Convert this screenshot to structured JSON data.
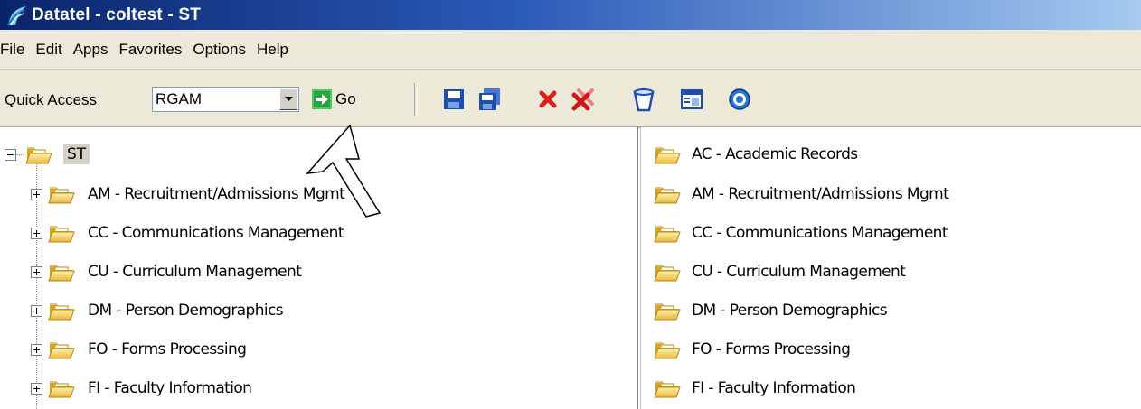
{
  "window": {
    "title": "Datatel - coltest - ST"
  },
  "menubar": {
    "items": [
      "File",
      "Edit",
      "Apps",
      "Favorites",
      "Options",
      "Help"
    ]
  },
  "toolbar": {
    "quick_access_label": "Quick Access",
    "quick_access_value": "RGAM",
    "go_label": "Go",
    "icons": [
      "save-icon",
      "save-all-icon",
      "cancel-icon",
      "cancel-all-icon",
      "clear-icon",
      "form-list-icon",
      "help-icon"
    ]
  },
  "tree": {
    "root": {
      "label": "ST"
    },
    "children": [
      "AM - Recruitment/Admissions Mgmt",
      "CC - Communications Management",
      "CU - Curriculum Management",
      "DM - Person Demographics",
      "FO - Forms Processing",
      "FI - Faculty Information"
    ]
  },
  "right_pane": {
    "items": [
      "AC - Academic Records",
      "AM - Recruitment/Admissions Mgmt",
      "CC - Communications Management",
      "CU - Curriculum Management",
      "DM - Person Demographics",
      "FO - Forms Processing",
      "FI - Faculty Information"
    ]
  },
  "colors": {
    "title_gradient_start": "#0a246a",
    "title_gradient_end": "#a6caf0",
    "chrome": "#ece9d8",
    "folder_yellow": "#f5d76e",
    "go_green": "#1fa83c",
    "save_blue": "#1c4fb0",
    "cancel_red": "#e01e1e"
  }
}
